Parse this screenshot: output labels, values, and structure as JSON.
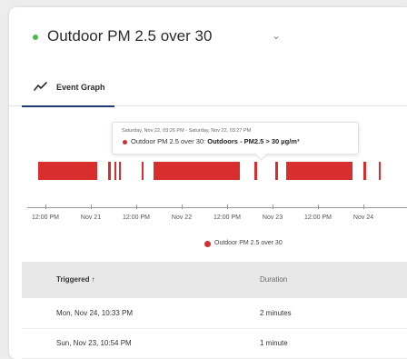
{
  "header": {
    "title": "Outdoor PM 2.5 over 30",
    "status_color": "#4cbb4a"
  },
  "tabs": [
    {
      "label": "Event Graph",
      "icon": "line-chart-icon",
      "active": true
    }
  ],
  "tooltip": {
    "time": "Saturday, Nov 22, 03:26 PM - Saturday, Nov 22, 03:27 PM",
    "series": "Outdoor PM 2.5 over 30:",
    "value": "Outdoors - PM2.5 > 30 µg/m³"
  },
  "chart_data": {
    "type": "timeline",
    "series": [
      {
        "name": "Outdoor PM 2.5 over 30",
        "color": "#d92e2e",
        "events": [
          {
            "start": "2025-11-20 10:10",
            "end": "2025-11-21 01:40"
          },
          {
            "start": "2025-11-21 04:30",
            "end": "2025-11-21 05:10"
          },
          {
            "start": "2025-11-21 06:20",
            "end": "2025-11-21 06:40"
          },
          {
            "start": "2025-11-21 07:30",
            "end": "2025-11-21 08:00"
          },
          {
            "start": "2025-11-21 13:20",
            "end": "2025-11-21 13:50"
          },
          {
            "start": "2025-11-21 16:40",
            "end": "2025-11-22 15:20"
          },
          {
            "start": "2025-11-22 19:10",
            "end": "2025-11-22 19:50"
          },
          {
            "start": "2025-11-23 00:40",
            "end": "2025-11-23 01:20"
          },
          {
            "start": "2025-11-23 03:40",
            "end": "2025-11-23 21:10"
          },
          {
            "start": "2025-11-24 00:00",
            "end": "2025-11-24 00:40"
          },
          {
            "start": "2025-11-24 04:00",
            "end": "2025-11-24 04:30"
          }
        ]
      }
    ],
    "x_ticks": [
      "12:00 PM",
      "Nov 21",
      "12:00 PM",
      "Nov 22",
      "12:00 PM",
      "Nov 23",
      "12:00 PM",
      "Nov 24"
    ],
    "legend": "Outdoor PM 2.5 over 30",
    "legend_position": "bottom-center"
  },
  "table": {
    "headers": {
      "triggered": "Triggered ↑",
      "duration": "Duration"
    },
    "rows": [
      {
        "triggered": "Mon, Nov 24, 10:33 PM",
        "duration": "2 minutes"
      },
      {
        "triggered": "Sun, Nov 23, 10:54 PM",
        "duration": "1 minute"
      }
    ]
  }
}
